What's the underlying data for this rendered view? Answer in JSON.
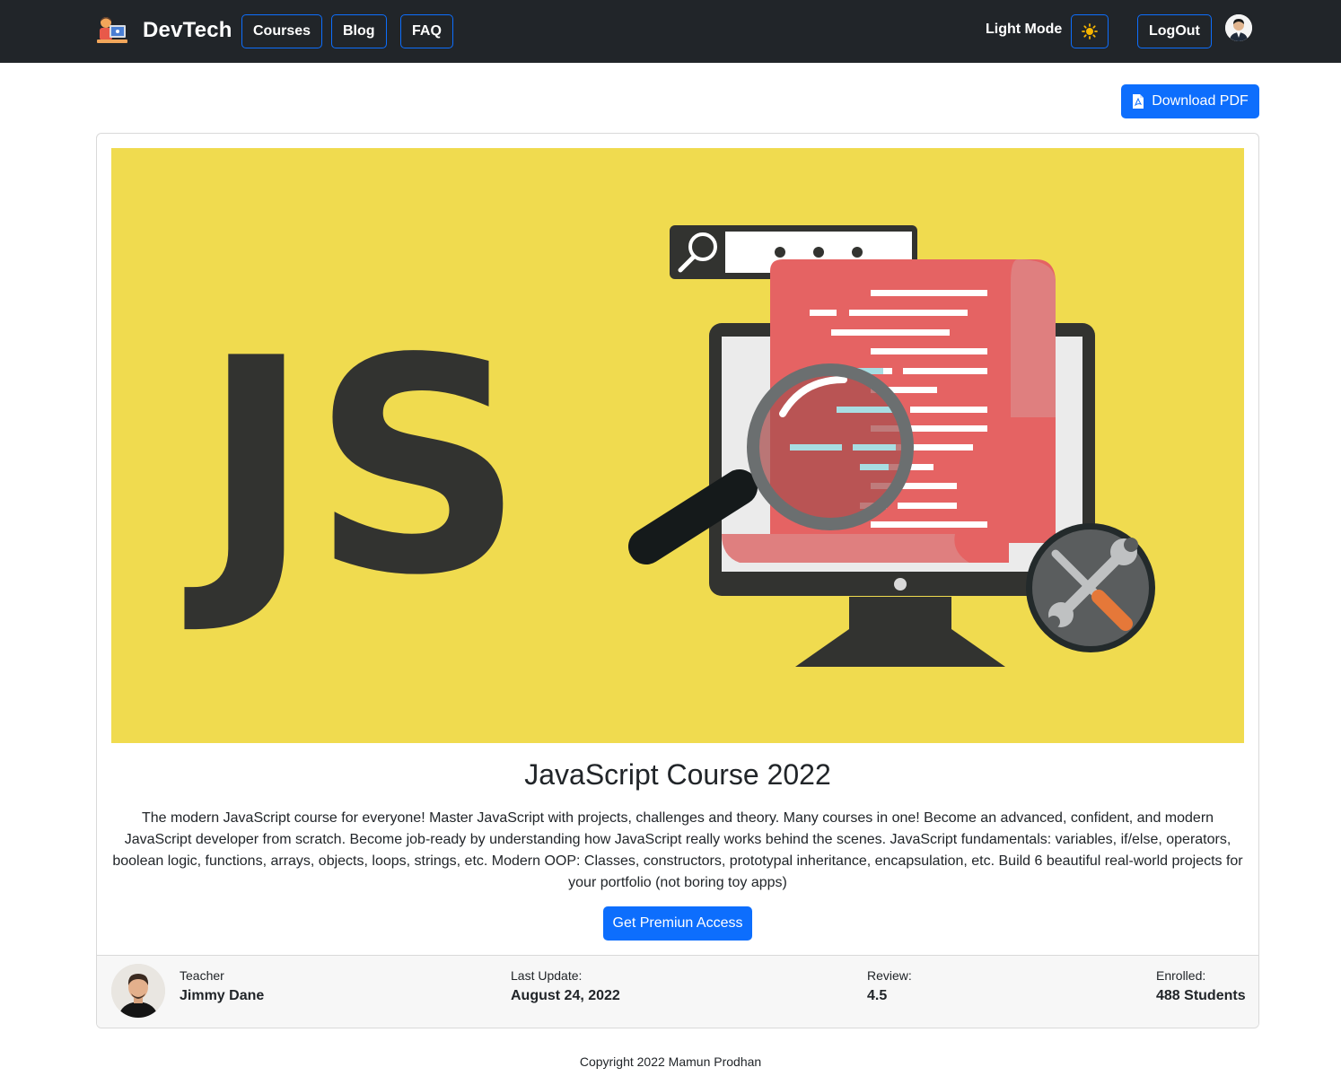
{
  "nav": {
    "brand": "DevTech",
    "links": [
      "Courses",
      "Blog",
      "FAQ"
    ],
    "mode_label": "Light Mode",
    "logout": "LogOut"
  },
  "actions": {
    "download_pdf": "Download PDF"
  },
  "course": {
    "banner_text": "JS",
    "title": "JavaScript Course 2022",
    "description": "The modern JavaScript course for everyone! Master JavaScript with projects, challenges and theory. Many courses in one! Become an advanced, confident, and modern JavaScript developer from scratch. Become job-ready by understanding how JavaScript really works behind the scenes. JavaScript fundamentals: variables, if/else, operators, boolean logic, functions, arrays, objects, loops, strings, etc. Modern OOP: Classes, constructors, prototypal inheritance, encapsulation, etc. Build 6 beautiful real-world projects for your portfolio (not boring toy apps)",
    "cta": "Get Premiun Access"
  },
  "meta": {
    "teacher_label": "Teacher",
    "teacher_name": "Jimmy Dane",
    "update_label": "Last Update:",
    "update_value": "August 24, 2022",
    "review_label": "Review:",
    "review_value": "4.5",
    "enrolled_label": "Enrolled:",
    "enrolled_value": "488 Students"
  },
  "footer": {
    "copyright": "Copyright 2022 Mamun Prodhan"
  },
  "colors": {
    "navbar": "#212529",
    "primary": "#0d6efd",
    "banner": "#f0db4f"
  }
}
